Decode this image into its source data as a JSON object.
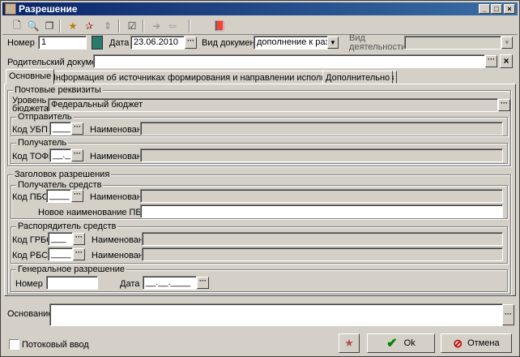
{
  "window": {
    "title": "Разрешение"
  },
  "toolbar": {
    "icons": [
      "new-doc-icon",
      "view-doc-icon",
      "copy-doc-icon",
      "star-add-icon",
      "star-remove-icon",
      "refresh-icon",
      "checklist-icon",
      "forward-icon",
      "back-icon",
      "book-icon"
    ]
  },
  "header": {
    "number_label": "Номер",
    "number_value": "1",
    "date_label": "Дата",
    "date_value": "23.06.2010",
    "doctype_label": "Вид документа",
    "doctype_value": "дополнение к разреше",
    "activity_label": "Вид деятельности",
    "activity_value": "",
    "parent_label": "Родительский документ",
    "parent_value": ""
  },
  "tabs": [
    "Основные",
    "Информация об источниках формирования и направлении использования средств",
    "Дополнительно"
  ],
  "postal": {
    "title": "Почтовые реквизиты",
    "budget_label": "Уровень бюджета",
    "budget_value": "Федеральный бюджет"
  },
  "sender": {
    "title": "Отправитель",
    "code_label": "Код УБП",
    "code_value": "____",
    "name_label": "Наименование",
    "name_value": ""
  },
  "receiver": {
    "title": "Получатель",
    "code_label": "Код ТОФК",
    "code_value": "__.__",
    "name_label": "Наименование",
    "name_value": ""
  },
  "permission": {
    "title": "Заголовок разрешения",
    "recipient_title": "Получатель средств",
    "pbs_label": "Код ПБС",
    "pbs_value": "____",
    "pbs_name_label": "Наименование",
    "pbs_name_value": "",
    "new_name_label": "Новое наименование ПБС",
    "new_name_value": "",
    "manager_title": "Распорядитель средств",
    "grbs_label": "Код ГРБС",
    "grbs_value": "___",
    "grbs_name_label": "Наименование",
    "rbs_label": "Код РБС",
    "rbs_value": "____",
    "rbs_name_label": "Наименование",
    "general_title": "Генеральное разрешение",
    "gen_number_label": "Номер",
    "gen_number_value": "",
    "gen_date_label": "Дата",
    "gen_date_value": "__.__.____"
  },
  "basis": {
    "label": "Основание",
    "value": ""
  },
  "footer": {
    "stream_label": "Потоковый ввод",
    "ok_label": "Ok",
    "cancel_label": "Отмена"
  },
  "colors": {
    "title_start": "#0a246a",
    "title_end": "#3a6ea5",
    "face": "#d4d0c8",
    "ok_check": "#008000",
    "cancel_red": "#cc0000"
  }
}
